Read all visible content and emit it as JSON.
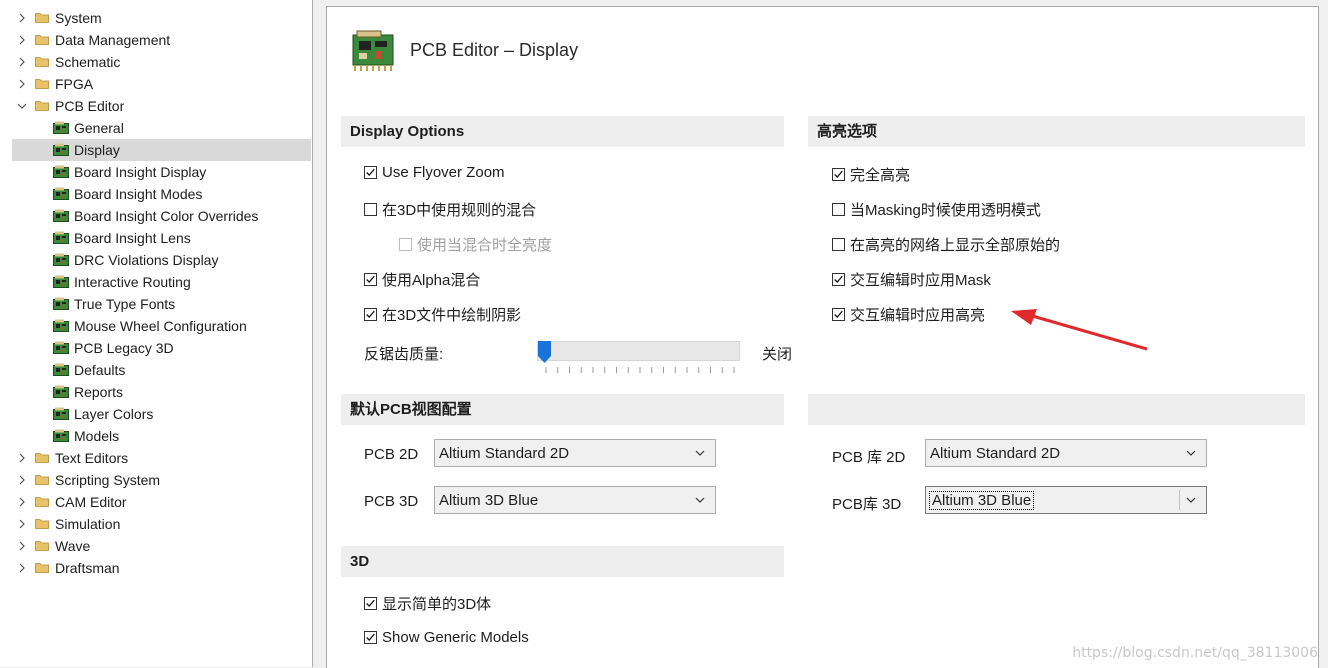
{
  "tree": {
    "items": [
      {
        "label": "System",
        "kind": "folder",
        "expanded": false
      },
      {
        "label": "Data Management",
        "kind": "folder",
        "expanded": false
      },
      {
        "label": "Schematic",
        "kind": "folder",
        "expanded": false
      },
      {
        "label": "FPGA",
        "kind": "folder",
        "expanded": false
      },
      {
        "label": "PCB Editor",
        "kind": "folder",
        "expanded": true
      },
      {
        "label": "General",
        "kind": "page"
      },
      {
        "label": "Display",
        "kind": "page",
        "selected": true
      },
      {
        "label": "Board Insight Display",
        "kind": "page"
      },
      {
        "label": "Board Insight Modes",
        "kind": "page"
      },
      {
        "label": "Board Insight Color Overrides",
        "kind": "page"
      },
      {
        "label": "Board Insight Lens",
        "kind": "page"
      },
      {
        "label": "DRC Violations Display",
        "kind": "page"
      },
      {
        "label": "Interactive Routing",
        "kind": "page"
      },
      {
        "label": "True Type Fonts",
        "kind": "page"
      },
      {
        "label": "Mouse Wheel Configuration",
        "kind": "page"
      },
      {
        "label": "PCB Legacy 3D",
        "kind": "page"
      },
      {
        "label": "Defaults",
        "kind": "page"
      },
      {
        "label": "Reports",
        "kind": "page"
      },
      {
        "label": "Layer Colors",
        "kind": "page"
      },
      {
        "label": "Models",
        "kind": "page"
      },
      {
        "label": "Text Editors",
        "kind": "folder",
        "expanded": false
      },
      {
        "label": "Scripting System",
        "kind": "folder",
        "expanded": false
      },
      {
        "label": "CAM Editor",
        "kind": "folder",
        "expanded": false
      },
      {
        "label": "Simulation",
        "kind": "folder",
        "expanded": false
      },
      {
        "label": "Wave",
        "kind": "folder",
        "expanded": false
      },
      {
        "label": "Draftsman",
        "kind": "folder",
        "expanded": false
      }
    ]
  },
  "page": {
    "title": "PCB Editor – Display"
  },
  "display_options": {
    "heading": "Display Options",
    "use_flyover_zoom": {
      "label": "Use Flyover Zoom",
      "checked": true
    },
    "use_rule_blend_3d": {
      "label": "在3D中使用规则的混合",
      "checked": false
    },
    "full_brightness_blend": {
      "label": "使用当混合时全亮度",
      "checked": false,
      "disabled": true
    },
    "use_alpha_blend": {
      "label": "使用Alpha混合",
      "checked": true
    },
    "draw_shadows_3d": {
      "label": "在3D文件中绘制阴影",
      "checked": true
    },
    "antialias_label": "反锯齿质量:",
    "antialias_value": "关闭",
    "antialias_level": 0
  },
  "highlight_options": {
    "heading": "高亮选项",
    "full_highlight": {
      "label": "完全高亮",
      "checked": true
    },
    "masking_transparent": {
      "label": "当Masking时候使用透明模式",
      "checked": false
    },
    "show_all_primitives": {
      "label": "在高亮的网络上显示全部原始的",
      "checked": false
    },
    "apply_mask_interactive": {
      "label": "交互编辑时应用Mask",
      "checked": true
    },
    "apply_highlight_interactive": {
      "label": "交互编辑时应用高亮",
      "checked": true
    }
  },
  "default_views": {
    "heading": "默认PCB视图配置",
    "pcb_2d_label": "PCB 2D",
    "pcb_2d_value": "Altium Standard 2D",
    "pcb_3d_label": "PCB 3D",
    "pcb_3d_value": "Altium 3D Blue",
    "lib_2d_label": "PCB 库 2D",
    "lib_2d_value": "Altium Standard 2D",
    "lib_3d_label": "PCB库 3D",
    "lib_3d_value": "Altium 3D Blue"
  },
  "three_d": {
    "heading": "3D",
    "show_simple_bodies": {
      "label": "显示简单的3D体",
      "checked": true
    },
    "show_generic_models": {
      "label": "Show Generic Models",
      "checked": true
    }
  },
  "watermark": "https://blog.csdn.net/qq_38113006",
  "colors": {
    "accent_thumb": "#1a73d9",
    "annotation_arrow": "#e0282d",
    "selection_bg": "#d9d9d9"
  }
}
